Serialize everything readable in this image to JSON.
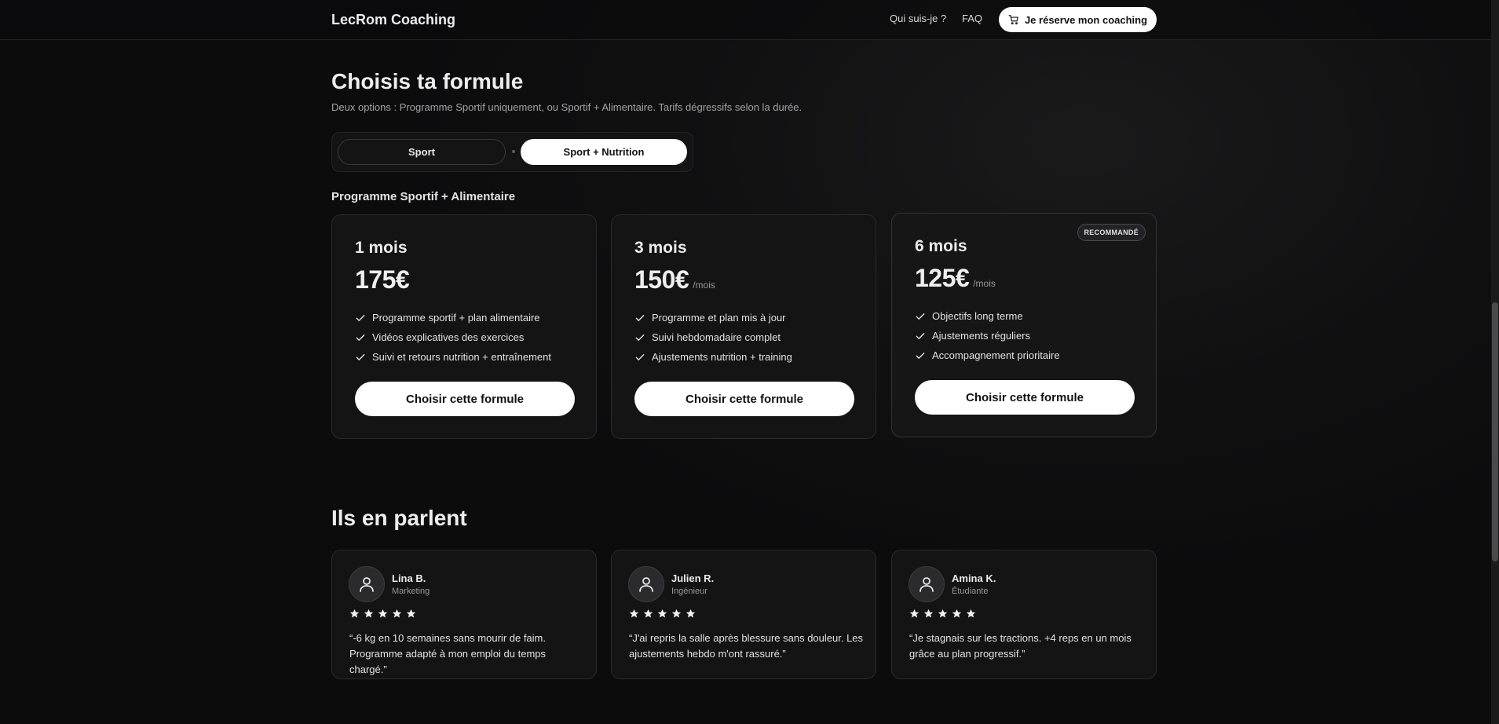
{
  "header": {
    "brand": "LecRom Coaching",
    "nav": [
      {
        "label": "Qui suis-je ?"
      },
      {
        "label": "FAQ"
      }
    ],
    "cta_label": "Je réserve mon coaching",
    "cta_icon": "cart-icon"
  },
  "pricing": {
    "title": "Choisis ta formule",
    "subtitle": "Deux options : Programme Sportif uniquement, ou Sportif + Alimentaire. Tarifs dégressifs selon la durée.",
    "toggle": {
      "options": [
        "Sport",
        "Sport + Nutrition"
      ],
      "selected": "Sport + Nutrition"
    },
    "section_label": "Programme Sportif + Alimentaire",
    "plans": [
      {
        "name": "1 mois",
        "price": "175€",
        "per": "",
        "features": [
          "Programme sportif + plan alimentaire",
          "Vidéos explicatives des exercices",
          "Suivi et retours nutrition + entraînement"
        ],
        "button": "Choisir cette formule"
      },
      {
        "name": "3 mois",
        "price": "150€",
        "per": "/mois",
        "features": [
          "Programme et plan mis à jour",
          "Suivi hebdomadaire complet",
          "Ajustements nutrition + training"
        ],
        "button": "Choisir cette formule"
      },
      {
        "name": "6 mois",
        "price": "125€",
        "per": "/mois",
        "badge": "RECOMMANDÉ",
        "features": [
          "Objectifs long terme",
          "Ajustements réguliers",
          "Accompagnement prioritaire"
        ],
        "button": "Choisir cette formule"
      }
    ]
  },
  "testimonials": {
    "title": "Ils en parlent",
    "items": [
      {
        "name": "Lina B.",
        "role": "Marketing",
        "rating": 5,
        "quote": "“-6 kg en 10 semaines sans mourir de faim. Programme adapté à mon emploi du temps chargé.”"
      },
      {
        "name": "Julien R.",
        "role": "Ingénieur",
        "rating": 5,
        "quote": "“J'ai repris la salle après blessure sans douleur. Les ajustements hebdo m'ont rassuré.”"
      },
      {
        "name": "Amina K.",
        "role": "Étudiante",
        "rating": 5,
        "quote": "“Je stagnais sur les tractions. +4 reps en un mois grâce au plan progressif.”"
      }
    ]
  }
}
